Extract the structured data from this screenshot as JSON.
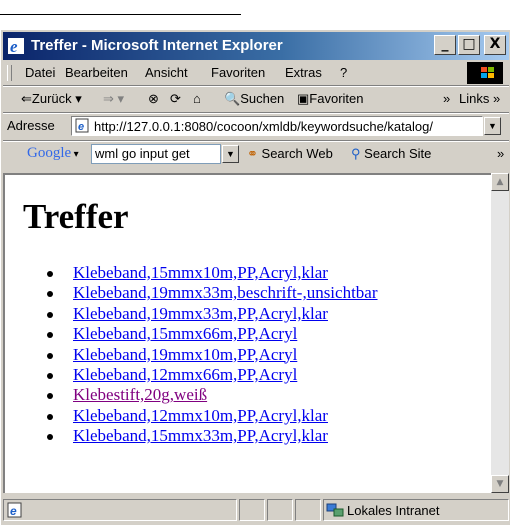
{
  "window": {
    "title": "Treffer - Microsoft Internet Explorer",
    "minimize": "_",
    "maximize": "□",
    "close": "X"
  },
  "menu": [
    "Datei",
    "Bearbeiten",
    "Ansicht",
    "Favoriten",
    "Extras",
    "?"
  ],
  "toolbar": {
    "back_label": "Zurück",
    "search_label": "Suchen",
    "favorites_label": "Favoriten",
    "links_label": "Links"
  },
  "address": {
    "label": "Adresse",
    "url": "http://127.0.0.1:8080/cocoon/xmldb/keywordsuche/katalog/"
  },
  "google": {
    "logo": "Google",
    "query": "wml go input get",
    "search_web": "Search Web",
    "search_site": "Search Site"
  },
  "page": {
    "heading": "Treffer",
    "links": [
      {
        "text": "Klebeband,15mmx10m,PP,Acryl,klar",
        "visited": false
      },
      {
        "text": "Klebeband,19mmx33m,beschrift-,unsichtbar",
        "visited": false
      },
      {
        "text": "Klebeband,19mmx33m,PP,Acryl,klar",
        "visited": false
      },
      {
        "text": "Klebeband,15mmx66m,PP,Acryl",
        "visited": false
      },
      {
        "text": "Klebeband,19mmx10m,PP,Acryl",
        "visited": false
      },
      {
        "text": "Klebeband,12mmx66m,PP,Acryl",
        "visited": false
      },
      {
        "text": "Klebestift,20g,weiß",
        "visited": true
      },
      {
        "text": "Klebeband,12mmx10m,PP,Acryl,klar",
        "visited": false
      },
      {
        "text": "Klebeband,15mmx33m,PP,Acryl,klar",
        "visited": false
      }
    ]
  },
  "statusbar": {
    "zone": "Lokales Intranet"
  },
  "colors": {
    "link": "#0000ee",
    "visited": "#800080",
    "titlebar_start": "#0a246a",
    "titlebar_end": "#a6caf0"
  }
}
